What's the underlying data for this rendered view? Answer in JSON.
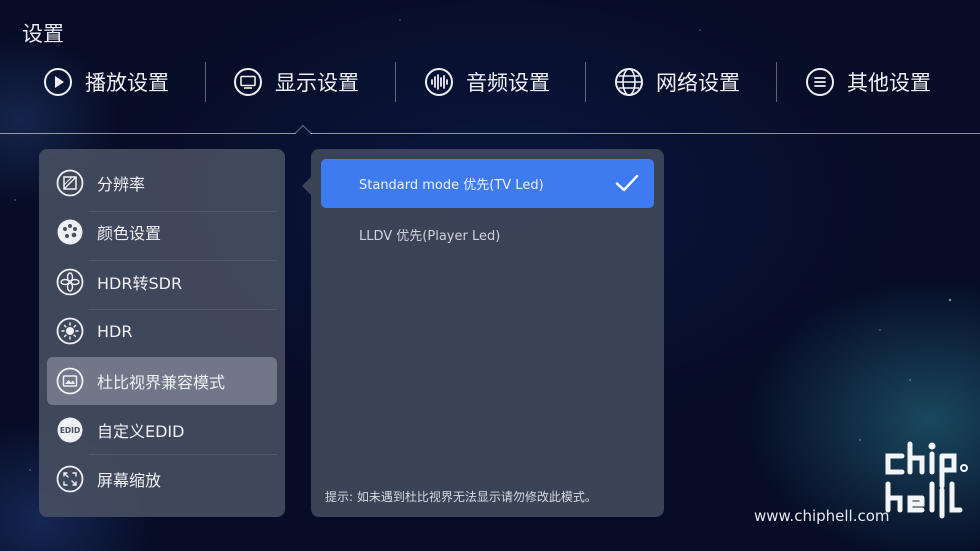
{
  "header": {
    "title": "设置"
  },
  "tabs": [
    {
      "label": "播放设置",
      "icon": "play-icon"
    },
    {
      "label": "显示设置",
      "icon": "monitor-icon",
      "selected": true
    },
    {
      "label": "音频设置",
      "icon": "audio-wave-icon"
    },
    {
      "label": "网络设置",
      "icon": "globe-icon"
    },
    {
      "label": "其他设置",
      "icon": "menu-icon"
    }
  ],
  "display_menu": {
    "items": [
      {
        "label": "分辨率",
        "icon": "resolution-icon"
      },
      {
        "label": "颜色设置",
        "icon": "palette-icon"
      },
      {
        "label": "HDR转SDR",
        "icon": "hdr-sdr-icon"
      },
      {
        "label": "HDR",
        "icon": "hdr-sun-icon"
      },
      {
        "label": "杜比视界兼容模式",
        "icon": "image-icon",
        "selected": true
      },
      {
        "label": "自定义EDID",
        "icon": "edid-icon"
      },
      {
        "label": "屏幕缩放",
        "icon": "screen-zoom-icon"
      }
    ]
  },
  "options_panel": {
    "options": [
      {
        "label": "Standard mode 优先(TV Led)",
        "selected": true
      },
      {
        "label": "LLDV 优先(Player Led)",
        "selected": false
      }
    ],
    "hint": "提示: 如未遇到杜比视界无法显示请勿修改此模式。"
  },
  "watermark": {
    "logo_text": "chip hell",
    "url": "www.chiphell.com"
  },
  "colors": {
    "accent": "#3e7bf0",
    "panel": "#485062",
    "background": "#070d26"
  }
}
